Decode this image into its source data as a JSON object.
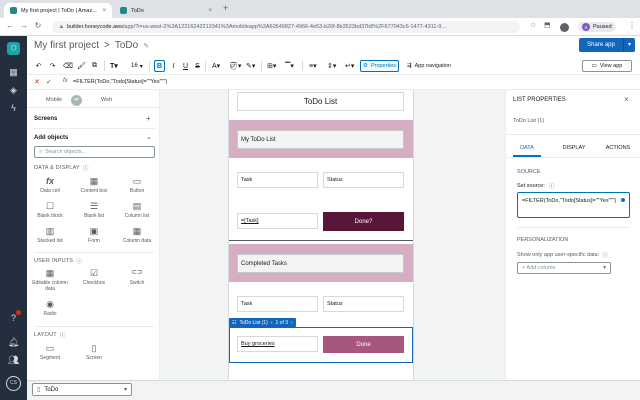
{
  "browser": {
    "tabs": [
      {
        "title": "My first project | ToDo | Amaz..."
      },
      {
        "title": "ToDo"
      }
    ],
    "url_host": "builder.honeycode.aws",
    "url_path": "/app/?i=us-west-2%3A12216242213341%3Amobileapp%3A60549827-4966-4e53-b20f-8b3523bd37b8%2F677043c6-1477-4311-9...",
    "profile_label": "Paused",
    "profile_initial": "S"
  },
  "rail": {
    "user_initials": "CS",
    "notification_count": "1"
  },
  "header": {
    "project": "My first project",
    "separator": ">",
    "app": "ToDo",
    "share_label": "Share app"
  },
  "toolbar": {
    "font_size": "16",
    "properties_label": "Properties",
    "app_navigation_label": "App navigation",
    "view_app_label": "View app"
  },
  "formula": {
    "expression": "=FILTER(ToDo,\"Todo[Status]=\"\"Yes\"\"\")"
  },
  "left": {
    "mobile_label": "Mobile",
    "web_label": "Web",
    "screens_label": "Screens",
    "add_objects_label": "Add objects",
    "search_placeholder": "Search objects...",
    "cat_data_display": "DATA & DISPLAY",
    "cat_user_inputs": "USER INPUTS",
    "cat_layout": "LAYOUT",
    "data_display": [
      {
        "label": "Data cell",
        "icon": "fx"
      },
      {
        "label": "Content box",
        "icon": "▦"
      },
      {
        "label": "Button",
        "icon": "▭"
      },
      {
        "label": "Blank block",
        "icon": "☐"
      },
      {
        "label": "Blank list",
        "icon": "☰"
      },
      {
        "label": "Column list",
        "icon": "▤"
      },
      {
        "label": "Stacked list",
        "icon": "▥"
      },
      {
        "label": "Form",
        "icon": "▣"
      },
      {
        "label": "Column data",
        "icon": "▦"
      }
    ],
    "user_inputs": [
      {
        "label": "Editable column data",
        "icon": "▦"
      },
      {
        "label": "Checkbox",
        "icon": "☑"
      },
      {
        "label": "Switch",
        "icon": "⊂⊃"
      },
      {
        "label": "Radio",
        "icon": "◉"
      }
    ],
    "layout": [
      {
        "label": "Segment",
        "icon": "▭"
      },
      {
        "label": "Screen",
        "icon": "▯"
      }
    ]
  },
  "canvas": {
    "title": "ToDo List",
    "my_list_header": "My ToDo List",
    "col_task": "Task",
    "col_status": "Status",
    "task_ref": "=[Task]",
    "done_q": "Done?",
    "completed_header": "Completed Tasks",
    "col_task2": "Task",
    "col_status2": "Status",
    "list_label": "ToDo List (1)",
    "list_pager": "1 of 3",
    "item_text": "Buy groceries",
    "done_label": "Done"
  },
  "right": {
    "title": "LIST PROPERTIES",
    "subtitle": "ToDo List (1)",
    "tabs": [
      "DATA",
      "DISPLAY",
      "ACTIONS"
    ],
    "source_label": "SOURCE",
    "set_source_label": "Set source:",
    "source_value": "=FILTER(ToDo,\"Todo[Status]=\"\"Yes\"\"\")",
    "personalization_label": "PERSONALIZATION",
    "show_only_label": "Show only app user-specific data:",
    "add_column_label": "+ Add column"
  },
  "bottom": {
    "screen_name": "ToDo"
  }
}
